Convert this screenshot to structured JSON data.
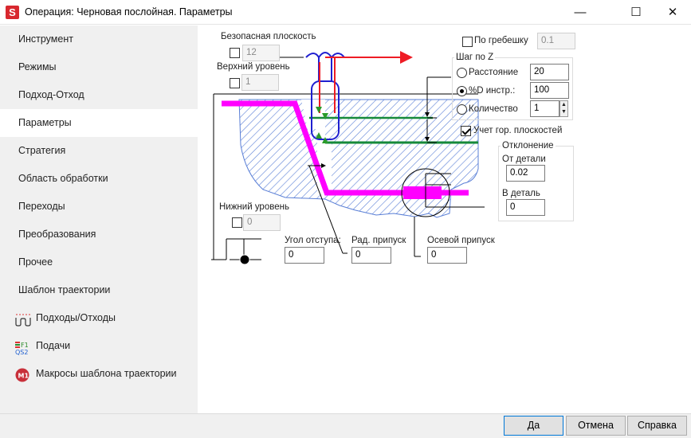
{
  "window": {
    "title": "Операция: Черновая послойная. Параметры",
    "app_icon_letter": "S"
  },
  "sidebar": {
    "items": [
      {
        "label": "Инструмент"
      },
      {
        "label": "Режимы"
      },
      {
        "label": "Подход-Отход"
      },
      {
        "label": "Параметры",
        "active": true
      },
      {
        "label": "Стратегия"
      },
      {
        "label": "Область обработки"
      },
      {
        "label": "Переходы"
      },
      {
        "label": "Преобразования"
      },
      {
        "label": "Прочее"
      },
      {
        "label": "Шаблон траектории"
      },
      {
        "label": "Подходы/Отходы",
        "icon": "approach-retract-icon"
      },
      {
        "label": "Подачи",
        "icon": "feeds-icon"
      },
      {
        "label": "Макросы шаблона траектории",
        "icon": "macro-icon"
      }
    ]
  },
  "params": {
    "safe_plane": {
      "label": "Безопасная плоскость",
      "value": "12",
      "checked": false
    },
    "top_level": {
      "label": "Верхний уровень",
      "value": "1",
      "checked": false
    },
    "bottom_level": {
      "label": "Нижний уровень",
      "value": "0",
      "checked": false
    },
    "by_ridge": {
      "label": "По гребешку",
      "value": "0.1",
      "checked": false
    },
    "z_step": {
      "group_label": "Шаг по Z",
      "distance": {
        "label": "Расстояние",
        "value": "20",
        "selected": false
      },
      "percent_d": {
        "label": "%D инстр.:",
        "value": "100",
        "selected": true
      },
      "count": {
        "label": "Количество",
        "value": "1",
        "selected": false
      }
    },
    "horizontal_planes": {
      "label": "Учет гор. плоскостей",
      "checked": true
    },
    "deviation": {
      "group_label": "Отклонение",
      "from_part": {
        "label": "От детали",
        "value": "0.02"
      },
      "into_part": {
        "label": "В деталь",
        "value": "0"
      }
    },
    "retract_angle": {
      "label": "Угол отступа:",
      "value": "0"
    },
    "radial_allowance": {
      "label": "Рад. припуск",
      "value": "0"
    },
    "axial_allowance": {
      "label": "Осевой припуск",
      "value": "0"
    }
  },
  "footer": {
    "ok": "Да",
    "cancel": "Отмена",
    "help": "Справка"
  },
  "colors": {
    "accent_red": "#ee1c25",
    "toolpath_magenta": "#ff00ff",
    "tool_blue": "#1f1fd0",
    "level_green": "#168a3a",
    "hatch_blue": "#5a7fd6"
  }
}
